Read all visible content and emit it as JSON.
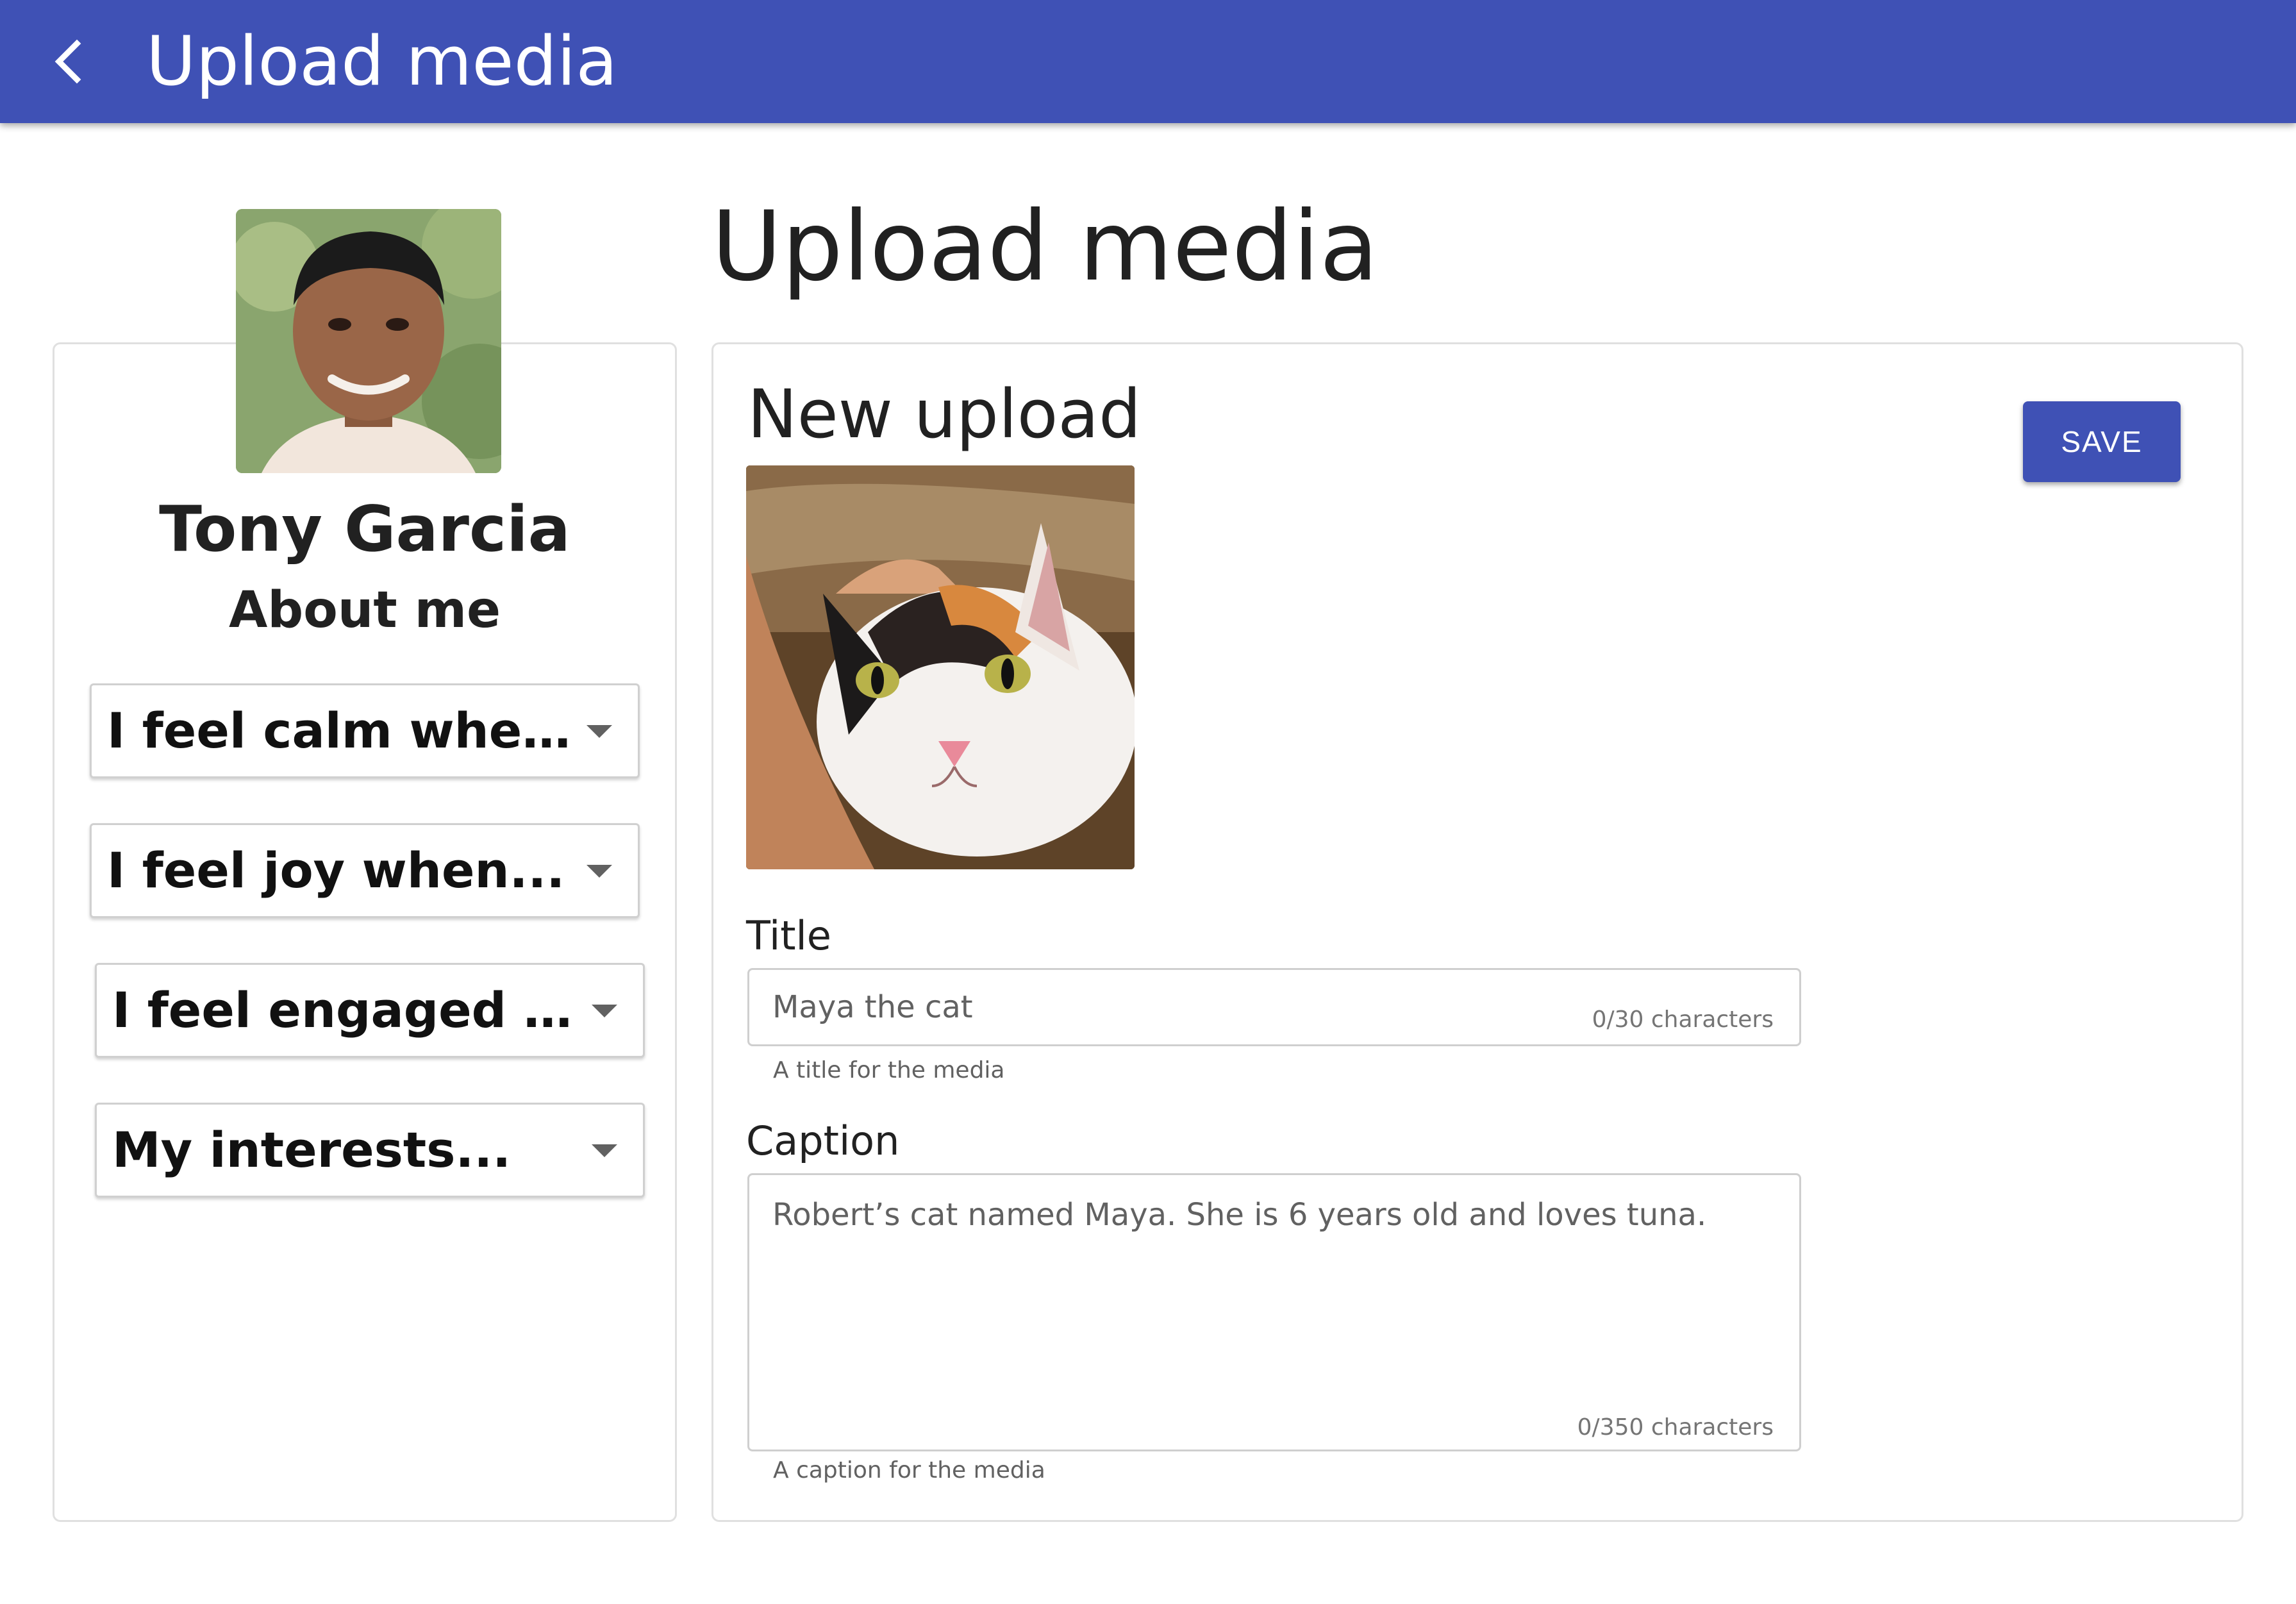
{
  "appbar": {
    "title": "Upload media",
    "back_icon": "chevron-left-icon"
  },
  "profile": {
    "name": "Tony Garcia",
    "section_title": "About me",
    "dropdowns": [
      {
        "label": "I feel calm when..."
      },
      {
        "label": "I feel joy when..."
      },
      {
        "label": "I feel engaged when..."
      },
      {
        "label": "My interests..."
      }
    ]
  },
  "main": {
    "heading": "Upload media",
    "card_title": "New upload",
    "save_label": "SAVE",
    "title_field": {
      "label": "Title",
      "value": "Maya the cat",
      "counter": "0/30 characters",
      "helper": "A title for the media"
    },
    "caption_field": {
      "label": "Caption",
      "value": "Robert’s cat named Maya. She is 6 years old and loves tuna.",
      "counter": "0/350 characters",
      "helper": "A caption for the media"
    }
  },
  "colors": {
    "primary": "#3f51b5",
    "appbar_text": "#ffffff"
  }
}
